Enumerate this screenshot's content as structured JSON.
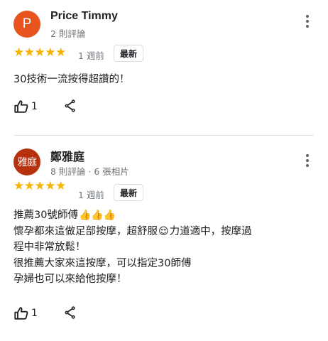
{
  "reviews": [
    {
      "avatar_text": "P",
      "avatar_color": "#e8541e",
      "name": "Price Timmy",
      "meta": "2 則評論",
      "stars": "★★★★★",
      "time": "1 週前",
      "badge": "最新",
      "lines": [
        "30技術一流按得超讚的！"
      ],
      "likes": "1"
    },
    {
      "avatar_text": "雅庭",
      "avatar_color": "#b8310f",
      "name": "鄭雅庭",
      "meta": "8 則評論 · 6 張相片",
      "stars": "★★★★★",
      "time": "1 週前",
      "badge": "最新",
      "line1_text": "推薦30號師傅",
      "line1_emoji": "👍👍👍",
      "line2_a": "懷孕都來這做足部按摩，超舒服",
      "line2_emoji": "😌",
      "line2_b": "力道適中，按摩過",
      "line3": "程中非常放鬆！",
      "line4": "很推薦大家來這按摩，可以指定30師傅",
      "line5": "孕婦也可以來給他按摩！",
      "likes": "1"
    }
  ],
  "icons": {
    "more": "more-vert-icon",
    "like": "thumb-up-icon",
    "share": "share-icon"
  },
  "colors": {
    "star": "#f6b400",
    "secondary_text": "#70757a",
    "divider": "#dadce0"
  }
}
